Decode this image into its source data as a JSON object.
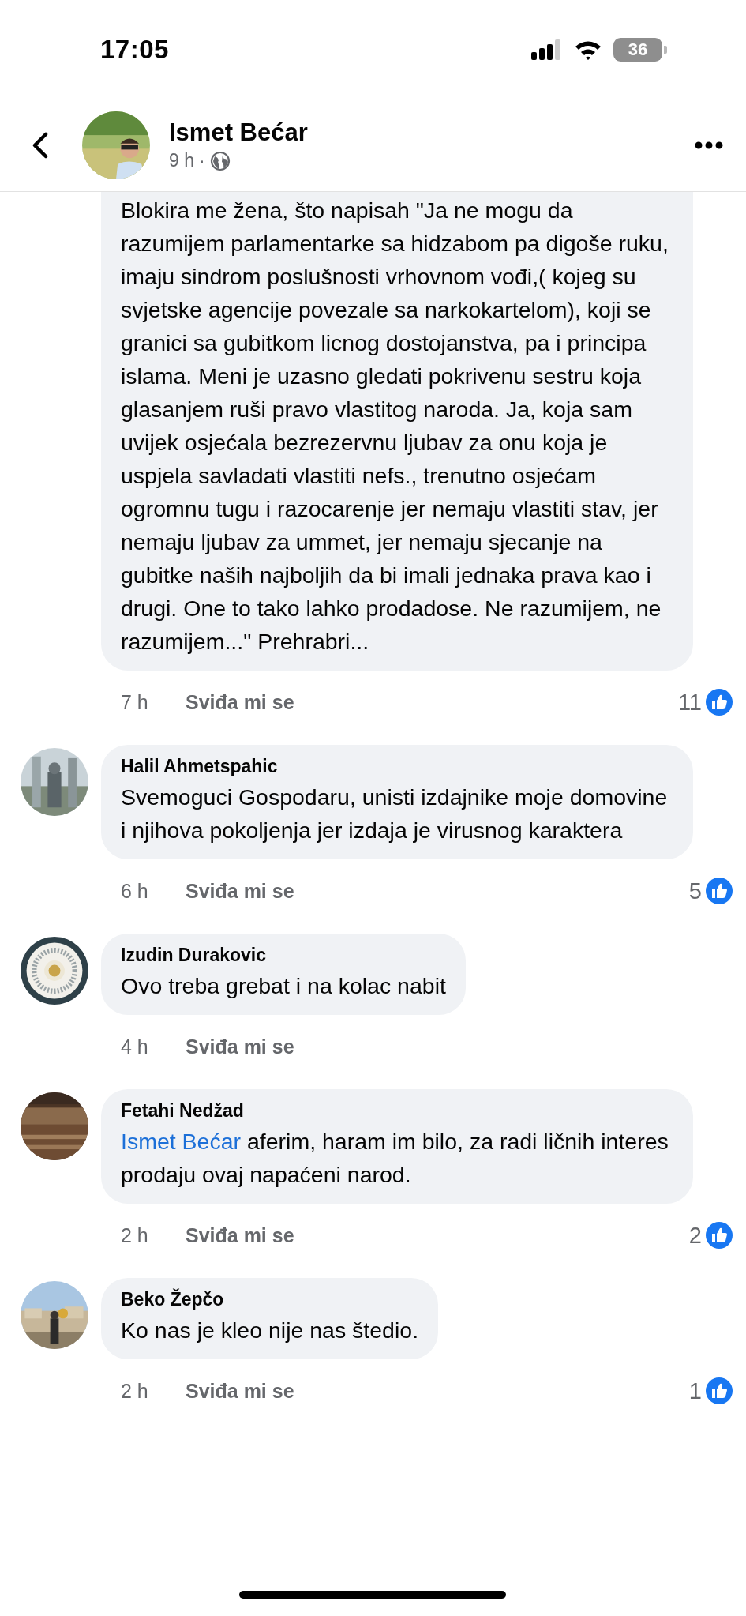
{
  "status_bar": {
    "time": "17:05",
    "battery": "36"
  },
  "header": {
    "name": "Ismet Bećar",
    "time": "9 h",
    "separator": "·"
  },
  "comments": [
    {
      "text": "Blokira me žena, što napisah \"Ja ne mogu da razumijem parlamentarke sa hidzabom pa digoše ruku, imaju sindrom poslušnosti vrhovnom vođi,( kojeg su  svjetske agencije povezale sa narkokartelom), koji se granici sa gubitkom licnog dostojanstva, pa i principa islama. Meni je uzasno gledati pokrivenu sestru koja glasanjem ruši pravo vlastitog naroda. Ja, koja sam uvijek osjećala bezrezervnu ljubav za onu koja je uspjela savladati vlastiti nefs., trenutno osjećam ogromnu tugu i razocarenje jer nemaju vlastiti stav, jer nemaju ljubav za ummet,   jer nemaju sjecanje na gubitke naših najboljih da bi imali jednaka prava kao i drugi. One to tako lahko prodadose. Ne razumijem, ne razumijem...\" Prehrabri...",
      "time": "7 h",
      "like_label": "Sviđa mi se",
      "likes": "11"
    },
    {
      "author": "Halil Ahmetspahic",
      "text": "Svemoguci Gospodaru, unisti izdajnike moje domovine i njihova pokoljenja jer izdaja je virusnog karaktera",
      "time": "6 h",
      "like_label": "Sviđa mi se",
      "likes": "5"
    },
    {
      "author": "Izudin Durakovic",
      "text": "Ovo treba grebat i na kolac nabit",
      "time": "4 h",
      "like_label": "Sviđa mi se"
    },
    {
      "author": "Fetahi Nedžad",
      "mention": "Ismet Bećar",
      "text": "aferim, haram im bilo, za radi ličnih interes prodaju ovaj napaćeni narod.",
      "time": "2 h",
      "like_label": "Sviđa mi se",
      "likes": "2"
    },
    {
      "author": "Beko Žepčo",
      "text": "Ko nas je kleo nije nas štedio.",
      "time": "2 h",
      "like_label": "Sviđa mi se",
      "likes": "1"
    }
  ]
}
